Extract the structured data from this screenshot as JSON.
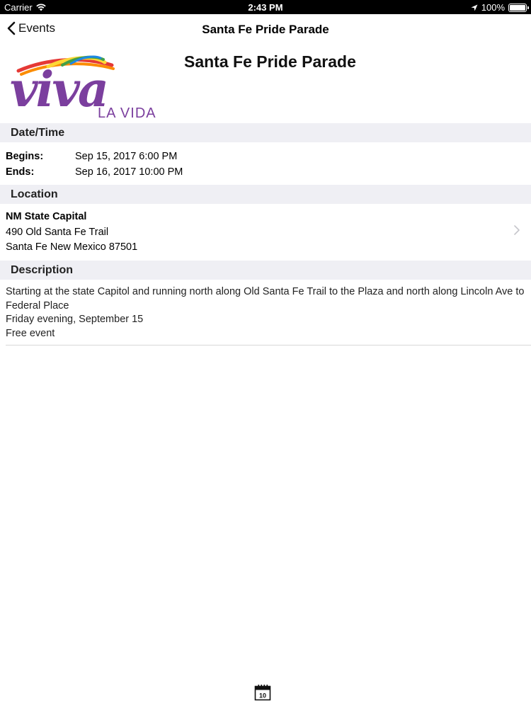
{
  "status_bar": {
    "carrier": "Carrier",
    "time": "2:43 PM",
    "battery": "100%"
  },
  "nav": {
    "back_label": "Events",
    "title": "Santa Fe Pride Parade"
  },
  "event": {
    "title": "Santa Fe Pride Parade",
    "logo": {
      "word": "viva",
      "subtitle": "LA VIDA"
    }
  },
  "datetime": {
    "header": "Date/Time",
    "begins_label": "Begins:",
    "begins_value": "Sep 15, 2017 6:00 PM",
    "ends_label": "Ends:",
    "ends_value": "Sep 16, 2017 10:00 PM"
  },
  "location": {
    "header": "Location",
    "name": "NM State Capital",
    "address_line1": "490 Old Santa Fe Trail",
    "address_line2": "Santa Fe New Mexico 87501"
  },
  "description": {
    "header": "Description",
    "lines": [
      "Starting at the state Capitol and running north along Old Santa Fe Trail to the Plaza and north along Lincoln Ave to Federal Place",
      "Friday evening, September 15",
      "Free event"
    ]
  },
  "tab_bar": {
    "calendar_day": "10"
  },
  "colors": {
    "logo_purple": "#7b3f9e",
    "section_bg": "#efeff4"
  }
}
